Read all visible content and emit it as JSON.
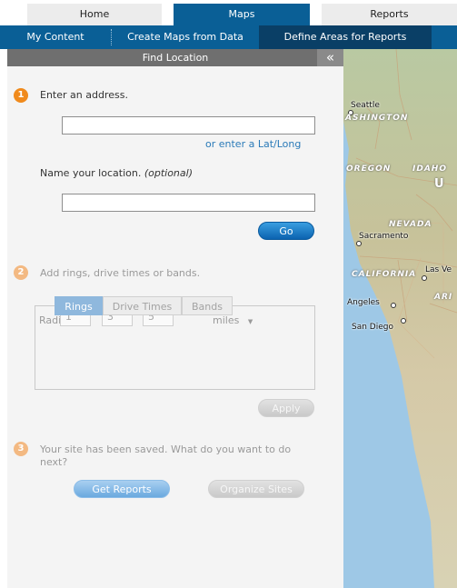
{
  "top_tabs": [
    "Home",
    "Maps",
    "Reports"
  ],
  "sub_nav": [
    "My Content",
    "Create Maps from Data",
    "Define Areas for Reports"
  ],
  "panel": {
    "title": "Find Location",
    "collapse_glyph": "«",
    "step1": {
      "number": "1",
      "label": "Enter an address.",
      "address_value": "",
      "latlong_link": "or enter a Lat/Long",
      "name_label": "Name your location.",
      "name_optional": "(optional)",
      "name_value": "",
      "go_button": "Go"
    },
    "step2": {
      "number": "2",
      "label": "Add rings, drive times or bands.",
      "tabs": [
        "Rings",
        "Drive Times",
        "Bands"
      ],
      "radius_label": "Radius:",
      "radius_values": [
        "1",
        "3",
        "5"
      ],
      "unit": "miles",
      "unit_arrow": "▼",
      "apply_button": "Apply"
    },
    "step3": {
      "number": "3",
      "label": "Your site has been saved. What do you want to do next?",
      "get_reports_button": "Get Reports",
      "organize_sites_button": "Organize Sites"
    }
  },
  "map": {
    "region_labels": [
      "ASHINGTON",
      "OREGON",
      "IDAHO",
      "NEVADA",
      "CALIFORNIA",
      "ARI"
    ],
    "cities": [
      "Seattle",
      "Sacramento",
      "Las Ve",
      "Angeles",
      "San Diego"
    ],
    "state_letter": "U"
  },
  "colors": {
    "nav_blue": "#0a5f96",
    "nav_active": "#0a3f66",
    "step_orange": "#f08a1c",
    "link_blue": "#2a7ab8",
    "ocean": "#9ec8e6"
  }
}
